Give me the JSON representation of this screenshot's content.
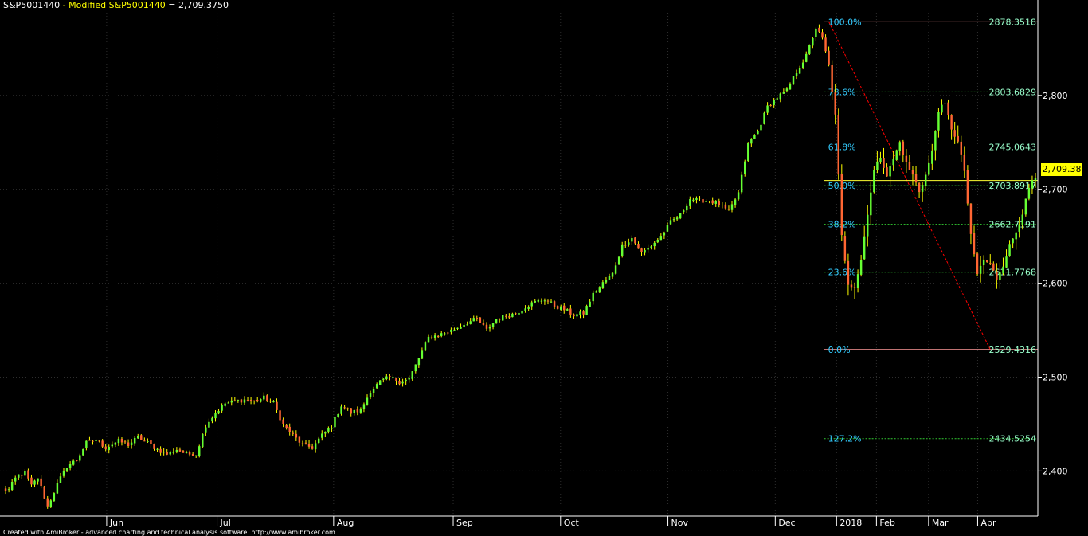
{
  "header": {
    "symbol": "S&P5001440",
    "separator": " - ",
    "series_name": "Modified S&P5001440",
    "equals": " = ",
    "last_value": "2,709.3750"
  },
  "footer_text": "Created with AmiBroker - advanced charting and technical analysis software. http://www.amibroker.com",
  "last_price_tag": "2,709.38",
  "colors": {
    "background": "#000000",
    "up_candle": "#66ff33",
    "down_candle": "#ff6633",
    "wick": "#ffff00",
    "grid": "#2e2e2e",
    "axis": "#ffffff",
    "fib_border": "#ff9999",
    "fib_level": "#33cc33",
    "fib_label_left": "#33ccff",
    "fib_label_right": "#99ffcc",
    "trendline": "#ff0000",
    "price_line": "#ffff33"
  },
  "chart_data": {
    "type": "candlestick",
    "title": "S&P5001440 - Modified S&P5001440 = 2,709.3750",
    "x_ticks": [
      "Jun",
      "Jul",
      "Aug",
      "Sep",
      "Oct",
      "Nov",
      "Dec",
      "2018",
      "Feb",
      "Mar",
      "Apr"
    ],
    "y_ticks": [
      2400,
      2500,
      2600,
      2700,
      2800
    ],
    "y_tick_labels": [
      "2,400",
      "2,500",
      "2,600",
      "2,700",
      "2,800"
    ],
    "ylim": [
      2352,
      2888
    ],
    "last_price": 2709.38,
    "path_anchors": [
      {
        "x": 2.0,
        "close": 2380
      },
      {
        "x": 4.5,
        "close": 2395
      },
      {
        "x": 7,
        "close": 2398
      },
      {
        "x": 9,
        "close": 2384
      },
      {
        "x": 11,
        "close": 2393
      },
      {
        "x": 14,
        "close": 2362
      },
      {
        "x": 17,
        "close": 2386
      },
      {
        "x": 20,
        "close": 2405
      },
      {
        "x": 23,
        "close": 2412
      },
      {
        "x": 26,
        "close": 2430
      },
      {
        "x": 29,
        "close": 2433
      },
      {
        "x": 32,
        "close": 2425
      },
      {
        "x": 36,
        "close": 2432
      },
      {
        "x": 39,
        "close": 2428
      },
      {
        "x": 42,
        "close": 2436
      },
      {
        "x": 45,
        "close": 2430
      },
      {
        "x": 48,
        "close": 2423
      },
      {
        "x": 51,
        "close": 2418
      },
      {
        "x": 54,
        "close": 2423
      },
      {
        "x": 57,
        "close": 2418
      },
      {
        "x": 60,
        "close": 2418
      },
      {
        "x": 63,
        "close": 2449
      },
      {
        "x": 66,
        "close": 2462
      },
      {
        "x": 69,
        "close": 2472
      },
      {
        "x": 72,
        "close": 2474
      },
      {
        "x": 75,
        "close": 2476
      },
      {
        "x": 78,
        "close": 2474
      },
      {
        "x": 81,
        "close": 2478
      },
      {
        "x": 84,
        "close": 2472
      },
      {
        "x": 87,
        "close": 2449
      },
      {
        "x": 90,
        "close": 2438
      },
      {
        "x": 93,
        "close": 2428
      },
      {
        "x": 96,
        "close": 2425
      },
      {
        "x": 99,
        "close": 2438
      },
      {
        "x": 102,
        "close": 2448
      },
      {
        "x": 105,
        "close": 2470
      },
      {
        "x": 108,
        "close": 2462
      },
      {
        "x": 111,
        "close": 2465
      },
      {
        "x": 114,
        "close": 2485
      },
      {
        "x": 117,
        "close": 2495
      },
      {
        "x": 120,
        "close": 2500
      },
      {
        "x": 123,
        "close": 2495
      },
      {
        "x": 126,
        "close": 2498
      },
      {
        "x": 129,
        "close": 2520
      },
      {
        "x": 132,
        "close": 2542
      },
      {
        "x": 135,
        "close": 2545
      },
      {
        "x": 138,
        "close": 2548
      },
      {
        "x": 141,
        "close": 2553
      },
      {
        "x": 144,
        "close": 2558
      },
      {
        "x": 147,
        "close": 2562
      },
      {
        "x": 150,
        "close": 2550
      },
      {
        "x": 153,
        "close": 2562
      },
      {
        "x": 156,
        "close": 2565
      },
      {
        "x": 159,
        "close": 2568
      },
      {
        "x": 162,
        "close": 2575
      },
      {
        "x": 165,
        "close": 2580
      },
      {
        "x": 168,
        "close": 2583
      },
      {
        "x": 171,
        "close": 2576
      },
      {
        "x": 174,
        "close": 2572
      },
      {
        "x": 177,
        "close": 2566
      },
      {
        "x": 180,
        "close": 2568
      },
      {
        "x": 183,
        "close": 2588
      },
      {
        "x": 186,
        "close": 2600
      },
      {
        "x": 189,
        "close": 2610
      },
      {
        "x": 192,
        "close": 2640
      },
      {
        "x": 195,
        "close": 2648
      },
      {
        "x": 198,
        "close": 2632
      },
      {
        "x": 201,
        "close": 2640
      },
      {
        "x": 204,
        "close": 2650
      },
      {
        "x": 207,
        "close": 2665
      },
      {
        "x": 210,
        "close": 2673
      },
      {
        "x": 213,
        "close": 2690
      },
      {
        "x": 216,
        "close": 2688
      },
      {
        "x": 219,
        "close": 2688
      },
      {
        "x": 222,
        "close": 2684
      },
      {
        "x": 225,
        "close": 2676
      },
      {
        "x": 228,
        "close": 2696
      },
      {
        "x": 231,
        "close": 2748
      },
      {
        "x": 234,
        "close": 2762
      },
      {
        "x": 237,
        "close": 2788
      },
      {
        "x": 240,
        "close": 2798
      },
      {
        "x": 243,
        "close": 2805
      },
      {
        "x": 246,
        "close": 2825
      },
      {
        "x": 249,
        "close": 2842
      },
      {
        "x": 252,
        "close": 2872
      },
      {
        "x": 254,
        "close": 2860
      },
      {
        "x": 256,
        "close": 2832
      },
      {
        "x": 258,
        "close": 2778
      },
      {
        "x": 260,
        "close": 2650
      },
      {
        "x": 262,
        "close": 2600
      },
      {
        "x": 264,
        "close": 2596
      },
      {
        "x": 266,
        "close": 2625
      },
      {
        "x": 268,
        "close": 2675
      },
      {
        "x": 270,
        "close": 2720
      },
      {
        "x": 272,
        "close": 2735
      },
      {
        "x": 274,
        "close": 2715
      },
      {
        "x": 276,
        "close": 2732
      },
      {
        "x": 278,
        "close": 2750
      },
      {
        "x": 280,
        "close": 2727
      },
      {
        "x": 282,
        "close": 2715
      },
      {
        "x": 284,
        "close": 2698
      },
      {
        "x": 286,
        "close": 2715
      },
      {
        "x": 288,
        "close": 2740
      },
      {
        "x": 290,
        "close": 2785
      },
      {
        "x": 292,
        "close": 2790
      },
      {
        "x": 294,
        "close": 2765
      },
      {
        "x": 296,
        "close": 2750
      },
      {
        "x": 298,
        "close": 2720
      },
      {
        "x": 300,
        "close": 2650
      },
      {
        "x": 302,
        "close": 2610
      },
      {
        "x": 304,
        "close": 2625
      },
      {
        "x": 306,
        "close": 2620
      },
      {
        "x": 308,
        "close": 2605
      },
      {
        "x": 310,
        "close": 2620
      },
      {
        "x": 312,
        "close": 2640
      },
      {
        "x": 314,
        "close": 2655
      },
      {
        "x": 316,
        "close": 2675
      },
      {
        "x": 318,
        "close": 2700
      },
      {
        "x": 319,
        "close": 2709.38
      }
    ],
    "fib_retracement": {
      "low": 2529.4316,
      "high": 2878.3518,
      "levels": [
        {
          "label": "100.0%",
          "value": "2878.3518",
          "price": 2878.3518
        },
        {
          "label": "78.6%",
          "value": "2803.6829",
          "price": 2803.6829
        },
        {
          "label": "61.8%",
          "value": "2745.0643",
          "price": 2745.0643
        },
        {
          "label": "50.0%",
          "value": "2703.8917",
          "price": 2703.8917
        },
        {
          "label": "38.2%",
          "value": "2662.7191",
          "price": 2662.7191
        },
        {
          "label": "23.6%",
          "value": "2611.7768",
          "price": 2611.7768
        },
        {
          "label": "0.0%",
          "value": "2529.4316",
          "price": 2529.4316
        },
        {
          "label": "127.2%",
          "value": "2434.5254",
          "price": 2434.5254
        }
      ]
    },
    "trendline": {
      "from": {
        "x": 256,
        "price": 2878.3518
      },
      "to": {
        "x": 306,
        "price": 2529.4316
      }
    },
    "grid": true
  }
}
